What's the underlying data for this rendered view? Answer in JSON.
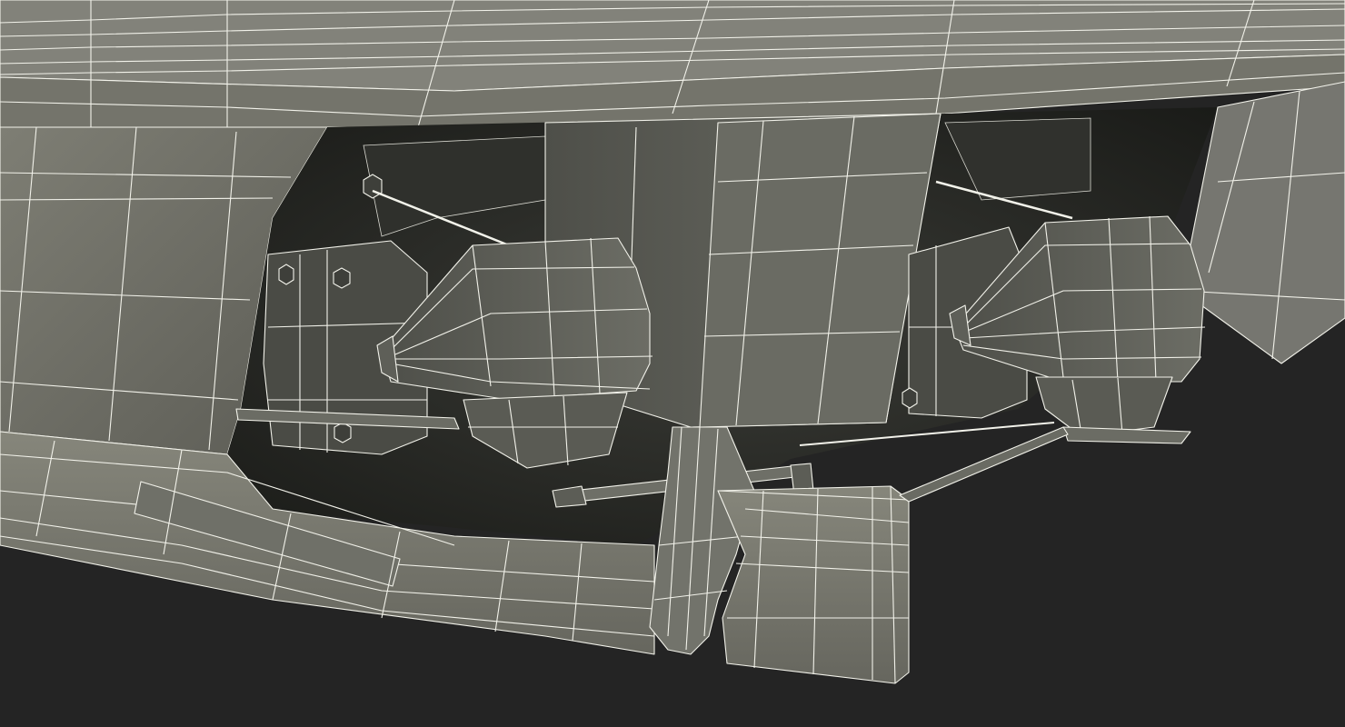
{
  "scene": {
    "subject": "",
    "render_style": "wireframe-over-shaded"
  },
  "colors": {
    "background": "#242424",
    "hull_light": "#7c7c72",
    "hull_mid": "#6d6d64",
    "hull_dark": "#55554d",
    "cavity": "#2a2a26",
    "cavity_deep": "#1c1d1a",
    "wire": "#f2f2ea"
  },
  "icons": {
    "left_thruster": "thruster-nozzle",
    "right_thruster": "thruster-nozzle",
    "bolt": "hex-bolt"
  }
}
